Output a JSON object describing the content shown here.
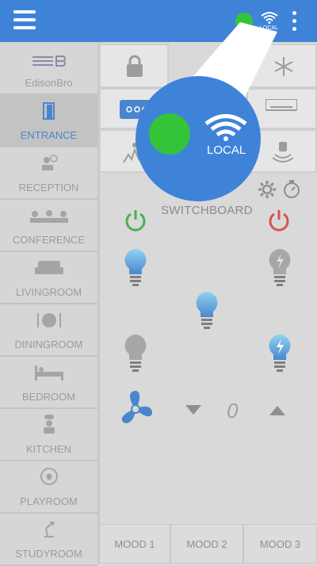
{
  "header": {
    "connection_mode": "LOCAL",
    "status_color": "#34c43a",
    "bar_color": "#3f83d8"
  },
  "sidebar": {
    "logo": "EdisonBro",
    "items": [
      {
        "label": "ENTRANCE",
        "icon": "door-icon",
        "active": true
      },
      {
        "label": "RECEPTION",
        "icon": "receptionist-icon",
        "active": false
      },
      {
        "label": "CONFERENCE",
        "icon": "conference-icon",
        "active": false
      },
      {
        "label": "LIVINGROOM",
        "icon": "sofa-icon",
        "active": false
      },
      {
        "label": "DININGROOM",
        "icon": "dining-icon",
        "active": false
      },
      {
        "label": "BEDROOM",
        "icon": "bed-icon",
        "active": false
      },
      {
        "label": "KITCHEN",
        "icon": "chef-icon",
        "active": false
      },
      {
        "label": "PLAYROOM",
        "icon": "soccer-ball-icon",
        "active": false
      },
      {
        "label": "STUDYROOM",
        "icon": "desk-lamp-icon",
        "active": false
      }
    ]
  },
  "main": {
    "switchboard_label": "SWITCHBOARD",
    "fan_speed": "0",
    "moods": [
      "MOOD 1",
      "MOOD 2",
      "MOOD 3"
    ],
    "accent_color": "#4a86cf",
    "power_on_color": "#4caf50",
    "power_off_color": "#d9534f"
  }
}
